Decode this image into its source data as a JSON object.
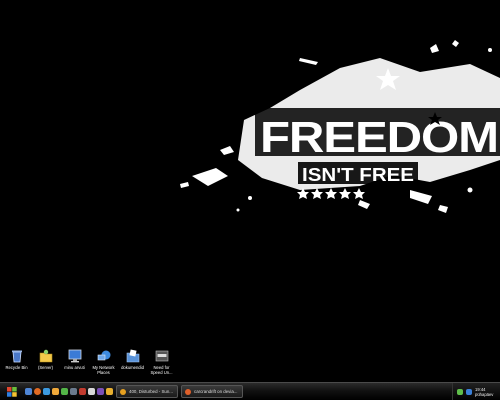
{
  "wallpaper": {
    "headline": "FREEDOM",
    "subline": "ISN'T FREE"
  },
  "desktop_icons": [
    {
      "label": "Recycle Bin",
      "icon": "recycle-bin-icon"
    },
    {
      "label": "(Server)",
      "icon": "server-folder-icon"
    },
    {
      "label": "minu arvuti",
      "icon": "my-computer-icon"
    },
    {
      "label": "My Network Places",
      "icon": "network-places-icon"
    },
    {
      "label": "dokumendid",
      "icon": "documents-icon"
    },
    {
      "label": "Need for Speed Un...",
      "icon": "game-shortcut-icon"
    }
  ],
  "taskbar": {
    "tasks": [
      {
        "label": "400, Disturbed - Sun...",
        "icon": "media-player-icon"
      },
      {
        "label": "carcrandrift on devia...",
        "icon": "browser-icon"
      }
    ],
    "clock_time": "19:44",
    "clock_day": "pühapäev"
  }
}
